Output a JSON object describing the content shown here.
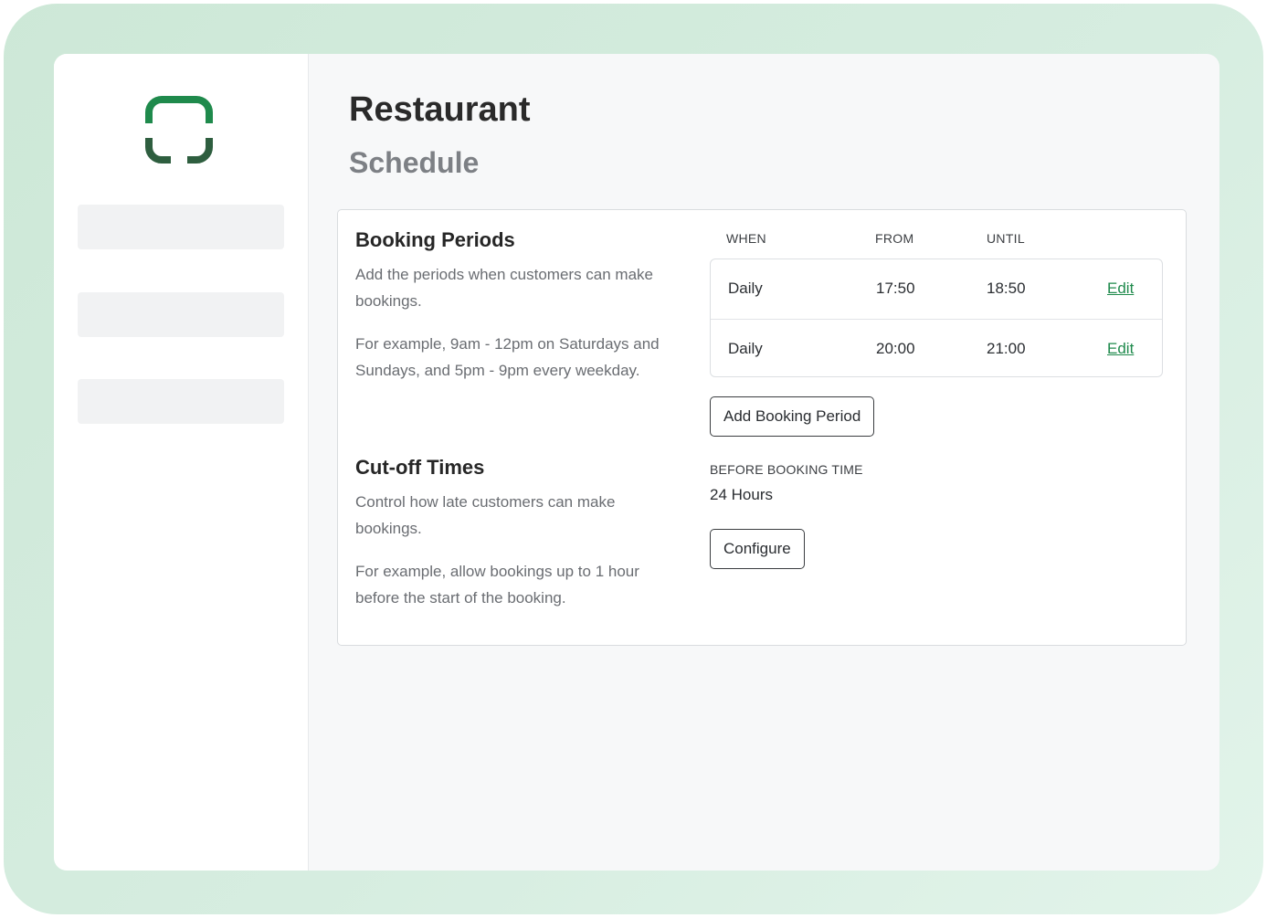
{
  "page": {
    "title": "Restaurant",
    "subtitle": "Schedule"
  },
  "colors": {
    "accent": "#1f8a4c",
    "logo_top": "#1f8a4c",
    "logo_bottom": "#2e5e3f"
  },
  "booking_periods": {
    "title": "Booking Periods",
    "description": "Add the periods when customers can make bookings.",
    "example": "For example, 9am - 12pm on Saturdays and Sundays, and 5pm - 9pm every weekday.",
    "columns": [
      "WHEN",
      "FROM",
      "UNTIL"
    ],
    "rows": [
      {
        "when": "Daily",
        "from": "17:50",
        "until": "18:50",
        "action": "Edit"
      },
      {
        "when": "Daily",
        "from": "20:00",
        "until": "21:00",
        "action": "Edit"
      }
    ],
    "add_button": "Add Booking Period"
  },
  "cutoff": {
    "title": "Cut-off Times",
    "description": "Control how late customers can make bookings.",
    "example": "For example, allow bookings up to 1 hour before the start of the booking.",
    "label": "BEFORE BOOKING TIME",
    "value": "24 Hours",
    "configure_button": "Configure"
  }
}
